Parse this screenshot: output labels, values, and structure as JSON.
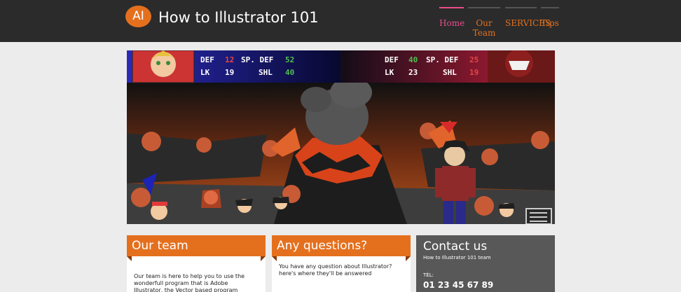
{
  "header": {
    "logo_text": "AI",
    "site_title": "How to Illustrator 101",
    "nav": [
      {
        "label": "Home",
        "active": true
      },
      {
        "label": "Our Team",
        "active": false
      },
      {
        "label": "SERVICES",
        "active": false
      },
      {
        "label": "Tips",
        "active": false
      }
    ]
  },
  "hero": {
    "left_panel": {
      "stats": [
        {
          "label": "DEF",
          "value": "12",
          "value_color": "#e64545"
        },
        {
          "label": "SP. DEF",
          "value": "52",
          "value_color": "#4fbf4f"
        },
        {
          "label": "LK",
          "value": "19",
          "value_color": "#ffffff"
        },
        {
          "label": "SHL",
          "value": "40",
          "value_color": "#4fbf4f"
        }
      ]
    },
    "right_panel": {
      "stats": [
        {
          "label": "DEF",
          "value": "40",
          "value_color": "#4fbf4f"
        },
        {
          "label": "SP. DEF",
          "value": "25",
          "value_color": "#e64545"
        },
        {
          "label": "LK",
          "value": "23",
          "value_color": "#ffffff"
        },
        {
          "label": "SHL",
          "value": "19",
          "value_color": "#e64545"
        }
      ]
    }
  },
  "cards": {
    "our_team": {
      "title": "Our team",
      "text": "Our team is here to help you to use the wonderfull program that is Adobe Illustrator, the Vector based program created by Adobe."
    },
    "questions": {
      "title": "Any questions?",
      "text": "You have any question about Illustrator? here's where they'll be answered"
    }
  },
  "contact": {
    "title": "Contact us",
    "subtitle": "How to Illustrator 101 team",
    "phone_label": "TÉL:",
    "phone": "01 23 45 67 89"
  },
  "colors": {
    "accent": "#e4701e",
    "active_nav": "#e94e8a",
    "topbar": "#2b2b2b"
  }
}
